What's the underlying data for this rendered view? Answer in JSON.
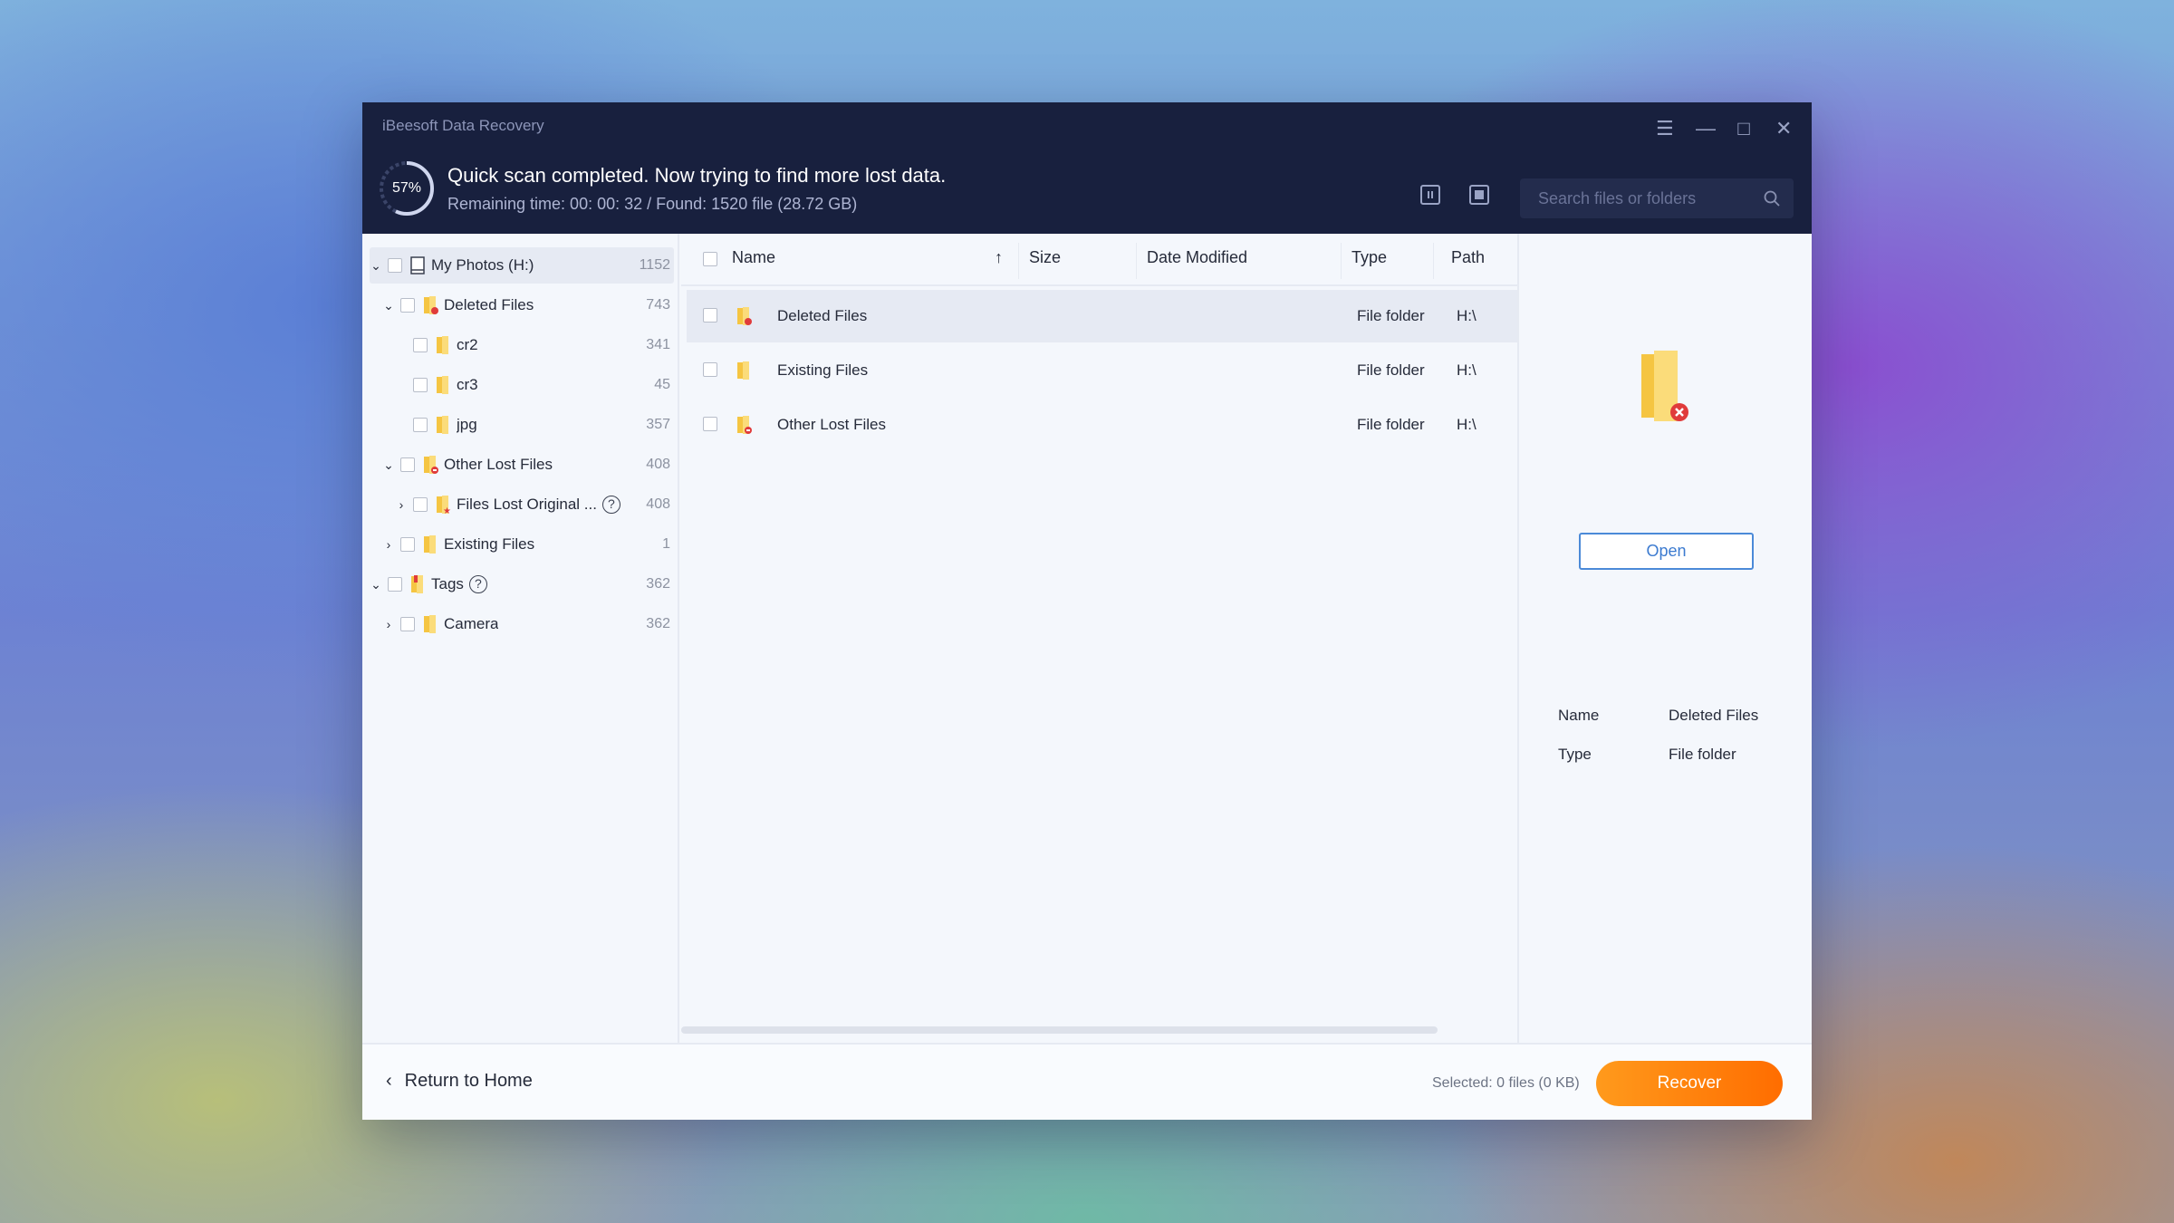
{
  "app": {
    "title": "iBeesoft Data Recovery"
  },
  "scan": {
    "progress_label": "57%",
    "progress_fraction": 0.57,
    "title": "Quick scan completed. Now trying to find more lost data.",
    "subtitle": "Remaining time: 00: 00: 32 / Found: 1520 file (28.72 GB)"
  },
  "search": {
    "placeholder": "Search files or folders"
  },
  "tree": [
    {
      "label": "My Photos (H:)",
      "count": "1152"
    },
    {
      "label": "Deleted Files",
      "count": "743"
    },
    {
      "label": "cr2",
      "count": "341"
    },
    {
      "label": "cr3",
      "count": "45"
    },
    {
      "label": "jpg",
      "count": "357"
    },
    {
      "label": "Other Lost Files",
      "count": "408"
    },
    {
      "label": "Files Lost Original ...",
      "count": "408"
    },
    {
      "label": "Existing Files",
      "count": "1"
    },
    {
      "label": "Tags",
      "count": "362"
    },
    {
      "label": "Camera",
      "count": "362"
    }
  ],
  "table": {
    "headers": {
      "name": "Name",
      "size": "Size",
      "date": "Date Modified",
      "type": "Type",
      "path": "Path"
    },
    "rows": [
      {
        "name": "Deleted Files",
        "type": "File folder",
        "path": "H:\\"
      },
      {
        "name": "Existing Files",
        "type": "File folder",
        "path": "H:\\"
      },
      {
        "name": "Other Lost Files",
        "type": "File folder",
        "path": "H:\\"
      }
    ]
  },
  "preview": {
    "open_label": "Open",
    "props": [
      {
        "key": "Name",
        "value": "Deleted Files"
      },
      {
        "key": "Type",
        "value": "File folder"
      }
    ]
  },
  "footer": {
    "back_label": "Return to Home",
    "selected_info": "Selected: 0 files (0 KB)",
    "recover_label": "Recover"
  },
  "colors": {
    "header_bg": "#18203e",
    "accent_orange": "#ff7a0c",
    "accent_blue": "#3c7bd0"
  }
}
